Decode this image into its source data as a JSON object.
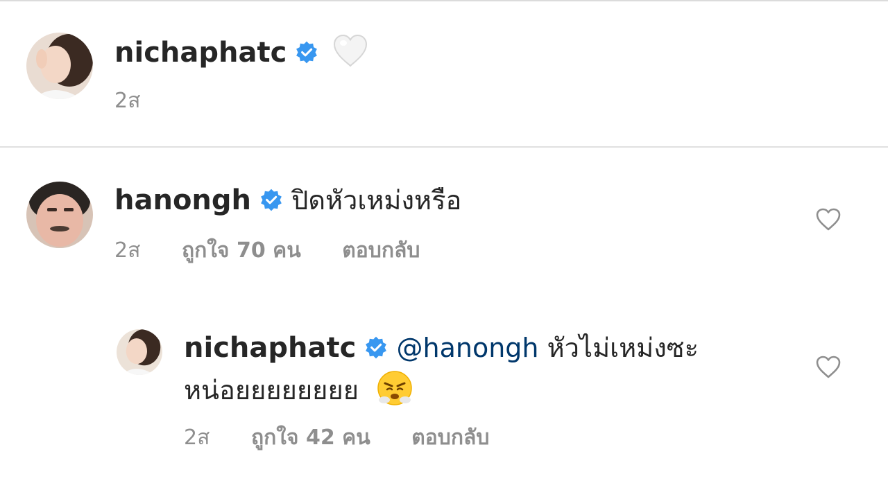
{
  "post": {
    "username": "nichaphatc",
    "caption_emoji": "🤍",
    "time": "2ส"
  },
  "comment": {
    "username": "hanongh",
    "text": "ปิดหัวเหม่งหรือ",
    "time": "2ส",
    "likes": "ถูกใจ 70 คน",
    "reply_label": "ตอบกลับ"
  },
  "reply": {
    "username": "nichaphatc",
    "mention": "@hanongh",
    "text_line1": "หัวไม่เหม่งซะ",
    "text_line2": "หน่อยยยยยยยย",
    "emoji": "😤",
    "time": "2ส",
    "likes": "ถูกใจ 42 คน",
    "reply_label": "ตอบกลับ"
  },
  "colors": {
    "verified": "#3897f0",
    "mention": "#00376b",
    "meta": "#8e8e8e",
    "divider": "#dbdbdb"
  },
  "icons": [
    "verified-badge-icon",
    "heart-outline-icon",
    "white-heart-emoji"
  ]
}
